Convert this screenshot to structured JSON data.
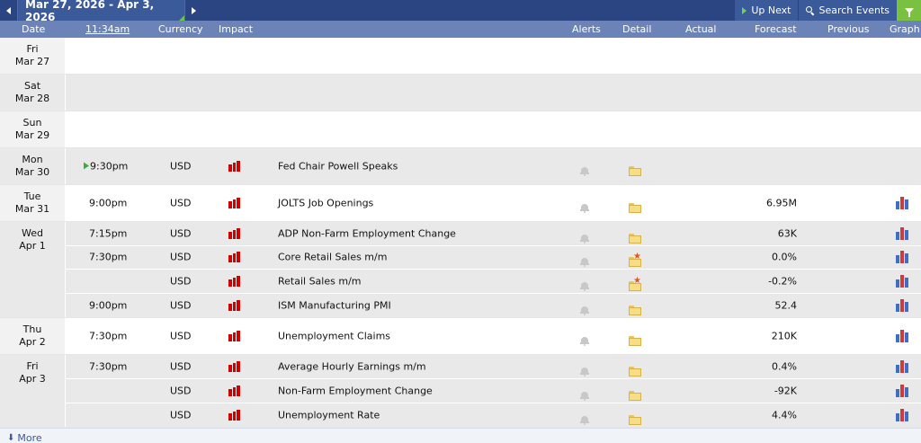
{
  "toolbar": {
    "date_range": "Mar 27, 2026 - Apr 3, 2026",
    "up_next_label": "Up Next",
    "search_label": "Search Events"
  },
  "header": {
    "date": "Date",
    "time": "11:34am",
    "currency": "Currency",
    "impact": "Impact",
    "alerts": "Alerts",
    "detail": "Detail",
    "actual": "Actual",
    "forecast": "Forecast",
    "previous": "Previous",
    "graph": "Graph"
  },
  "days": [
    {
      "weekday": "Fri",
      "date": "Mar 27",
      "events": []
    },
    {
      "weekday": "Sat",
      "date": "Mar 28",
      "events": []
    },
    {
      "weekday": "Sun",
      "date": "Mar 29",
      "events": []
    },
    {
      "weekday": "Mon",
      "date": "Mar 30",
      "events": [
        {
          "time": "9:30pm",
          "currency": "USD",
          "impact": "high",
          "name": "Fed Chair Powell Speaks",
          "detail_icon": "folder-icon",
          "previous": "",
          "graph": false,
          "live": true
        }
      ]
    },
    {
      "weekday": "Tue",
      "date": "Mar 31",
      "events": [
        {
          "time": "9:00pm",
          "currency": "USD",
          "impact": "high",
          "name": "JOLTS Job Openings",
          "detail_icon": "folder-icon",
          "previous": "6.95M",
          "graph": true,
          "live": false
        }
      ]
    },
    {
      "weekday": "Wed",
      "date": "Apr 1",
      "events": [
        {
          "time": "7:15pm",
          "currency": "USD",
          "impact": "high",
          "name": "ADP Non-Farm Employment Change",
          "detail_icon": "folder-icon",
          "previous": "63K",
          "graph": true,
          "live": false
        },
        {
          "time": "7:30pm",
          "currency": "USD",
          "impact": "high",
          "name": "Core Retail Sales m/m",
          "detail_icon": "folder-star-icon",
          "previous": "0.0%",
          "graph": true,
          "live": false
        },
        {
          "time": "",
          "currency": "USD",
          "impact": "high",
          "name": "Retail Sales m/m",
          "detail_icon": "folder-star-icon",
          "previous": "-0.2%",
          "graph": true,
          "live": false
        },
        {
          "time": "9:00pm",
          "currency": "USD",
          "impact": "high",
          "name": "ISM Manufacturing PMI",
          "detail_icon": "folder-icon",
          "previous": "52.4",
          "graph": true,
          "live": false
        }
      ]
    },
    {
      "weekday": "Thu",
      "date": "Apr 2",
      "events": [
        {
          "time": "7:30pm",
          "currency": "USD",
          "impact": "high",
          "name": "Unemployment Claims",
          "detail_icon": "folder-icon",
          "previous": "210K",
          "graph": true,
          "live": false
        }
      ]
    },
    {
      "weekday": "Fri",
      "date": "Apr 3",
      "events": [
        {
          "time": "7:30pm",
          "currency": "USD",
          "impact": "high",
          "name": "Average Hourly Earnings m/m",
          "detail_icon": "folder-icon",
          "previous": "0.4%",
          "graph": true,
          "live": false
        },
        {
          "time": "",
          "currency": "USD",
          "impact": "high",
          "name": "Non-Farm Employment Change",
          "detail_icon": "folder-icon",
          "previous": "-92K",
          "graph": true,
          "live": false
        },
        {
          "time": "",
          "currency": "USD",
          "impact": "high",
          "name": "Unemployment Rate",
          "detail_icon": "folder-icon",
          "previous": "4.4%",
          "graph": true,
          "live": false
        }
      ]
    }
  ],
  "footer": {
    "more_label": "More"
  },
  "colors": {
    "topbar": "#2a4582",
    "header": "#6b83b7",
    "impact_high": "#d40000",
    "filter": "#7ac142",
    "live": "#3ab03a"
  }
}
